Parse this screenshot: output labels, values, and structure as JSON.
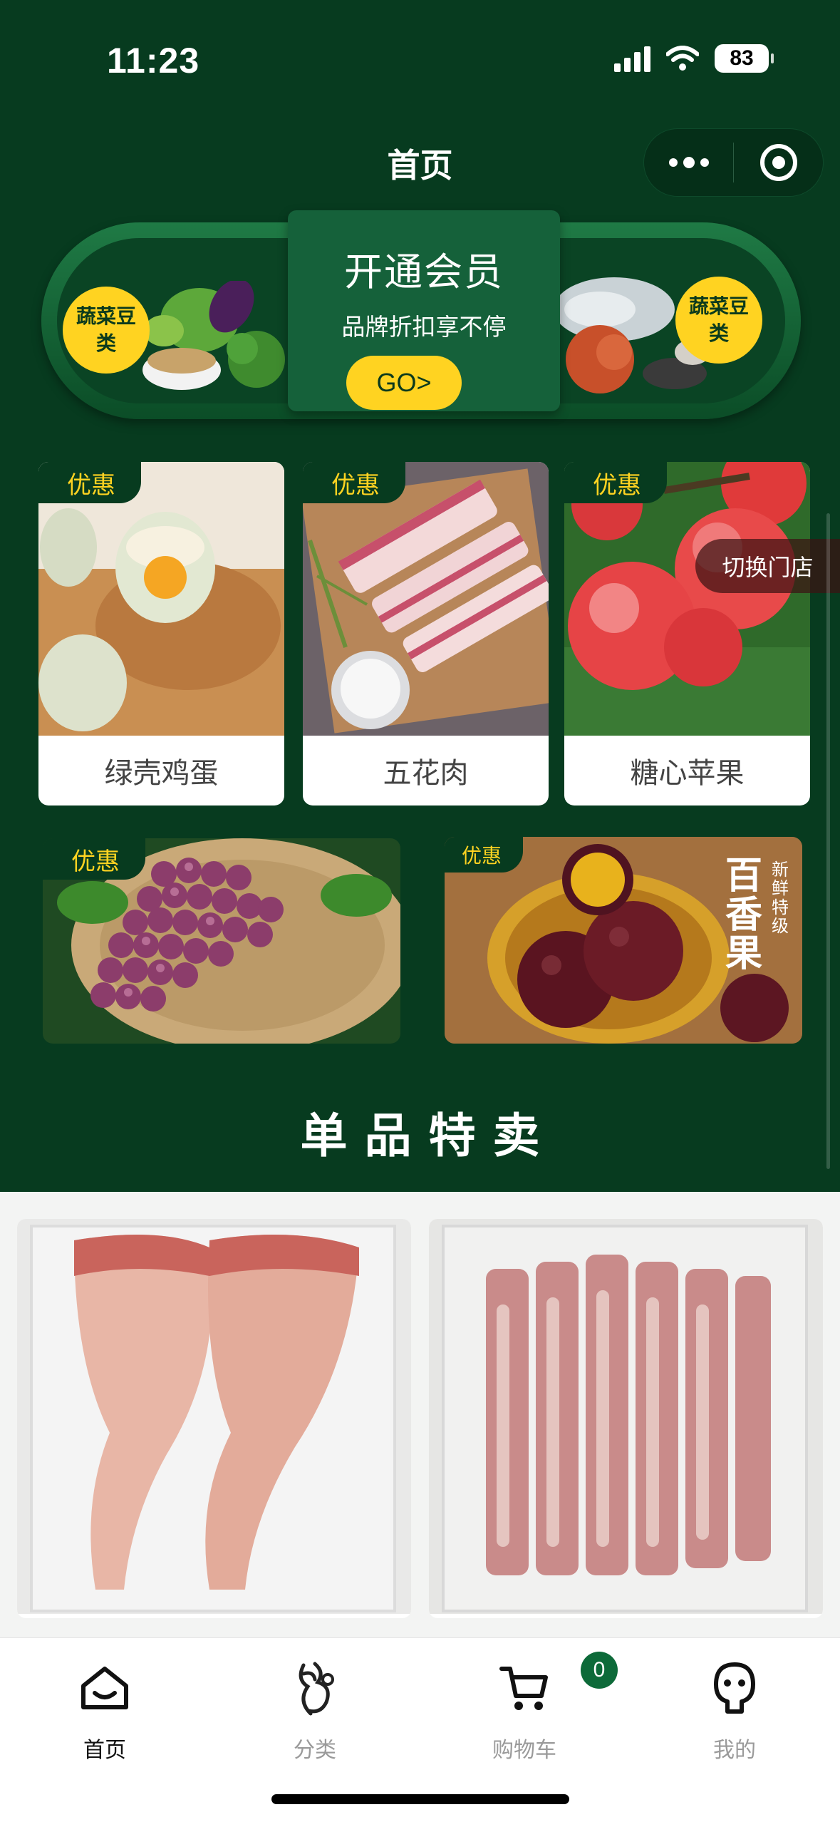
{
  "status_bar": {
    "time": "11:23",
    "battery": "83"
  },
  "nav": {
    "title": "首页"
  },
  "member_banner": {
    "left_tag": "蔬菜豆类",
    "right_tag": "蔬菜豆类",
    "title": "开通会员",
    "subtitle": "品牌折扣享不停",
    "button": "GO>"
  },
  "deal_badge": "优惠",
  "products": [
    {
      "name": "绿壳鸡蛋"
    },
    {
      "name": "五花肉"
    },
    {
      "name": "糖心苹果"
    }
  ],
  "wide_products": [
    {
      "name": "grapes"
    },
    {
      "name": "passion-fruit",
      "art_text": "百香果",
      "art_small": "新鲜特级"
    }
  ],
  "switch_store": "切换门店",
  "section_title": "单品特卖",
  "tabbar": {
    "items": [
      {
        "label": "首页",
        "icon": "home-icon"
      },
      {
        "label": "分类",
        "icon": "category-icon"
      },
      {
        "label": "购物车",
        "icon": "cart-icon"
      },
      {
        "label": "我的",
        "icon": "profile-icon"
      }
    ],
    "cart_count": "0"
  },
  "colors": {
    "brand_green": "#073b1f",
    "accent_yellow": "#ffd321"
  }
}
